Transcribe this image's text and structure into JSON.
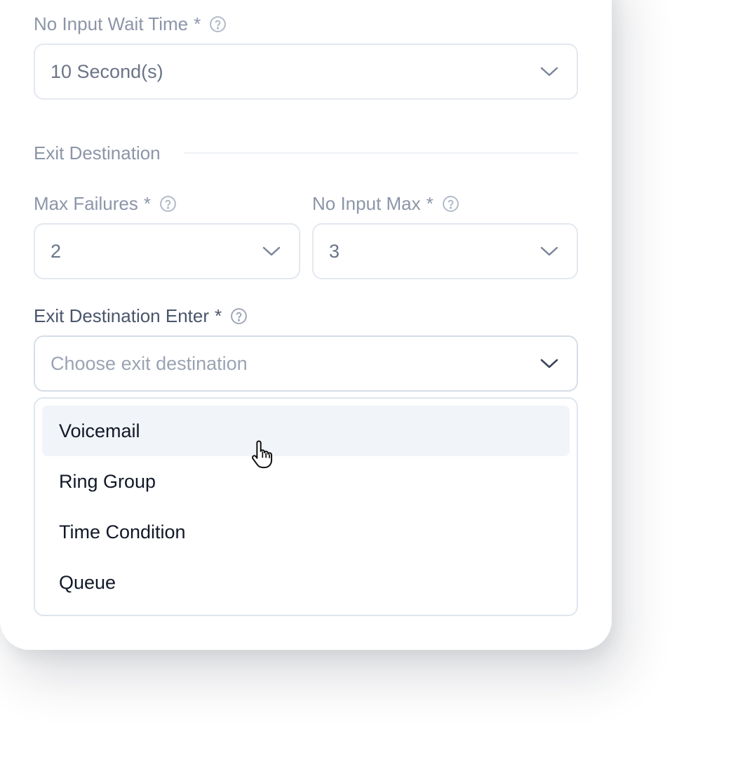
{
  "fields": {
    "no_input_wait_time": {
      "label": "No Input Wait Time",
      "required_mark": "*",
      "value": "10 Second(s)"
    },
    "section_exit_destination": {
      "title": "Exit Destination"
    },
    "max_failures": {
      "label": "Max Failures",
      "required_mark": "*",
      "value": "2"
    },
    "no_input_max": {
      "label": "No Input Max",
      "required_mark": "*",
      "value": "3"
    },
    "exit_destination_enter": {
      "label": "Exit Destination Enter",
      "required_mark": "*",
      "placeholder": "Choose exit destination",
      "options": [
        "Voicemail",
        "Ring Group",
        "Time Condition",
        "Queue"
      ],
      "hovered_option": "Voicemail"
    }
  },
  "icons": {
    "help": "question-circle-icon",
    "chevron": "chevron-down-icon",
    "cursor": "hand-pointer-cursor"
  },
  "colors": {
    "label_muted": "#8c95a8",
    "label_dark": "#4a556b",
    "field_border": "#e3e8ef",
    "option_hover_bg": "#f1f4f9",
    "option_text": "#111827"
  }
}
